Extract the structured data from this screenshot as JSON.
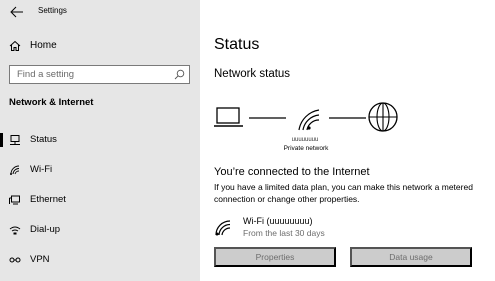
{
  "window": {
    "title": "Settings"
  },
  "sidebar": {
    "home_label": "Home",
    "search_placeholder": "Find a setting",
    "section_title": "Network & Internet",
    "items": [
      {
        "label": "Status",
        "icon": "status-icon",
        "selected": true
      },
      {
        "label": "Wi-Fi",
        "icon": "wifi-icon",
        "selected": false
      },
      {
        "label": "Ethernet",
        "icon": "ethernet-icon",
        "selected": false
      },
      {
        "label": "Dial-up",
        "icon": "dialup-icon",
        "selected": false
      },
      {
        "label": "VPN",
        "icon": "vpn-icon",
        "selected": false
      }
    ]
  },
  "main": {
    "title": "Status",
    "network_status_heading": "Network status",
    "diagram": {
      "network_name": "uuuuuuuu",
      "network_type": "Private network"
    },
    "connected_heading": "You’re connected to the Internet",
    "connected_desc": "If you have a limited data plan, you can make this network a metered connection or change other properties.",
    "connection": {
      "name": "Wi-Fi (uuuuuuuu)",
      "since": "From the last 30 days"
    },
    "buttons": {
      "properties": "Properties",
      "data_usage": "Data usage"
    }
  },
  "colors": {
    "sidebar_bg": "#e6e6e6",
    "button_bg": "#cccccc",
    "button_text": "#6d6d6d"
  }
}
